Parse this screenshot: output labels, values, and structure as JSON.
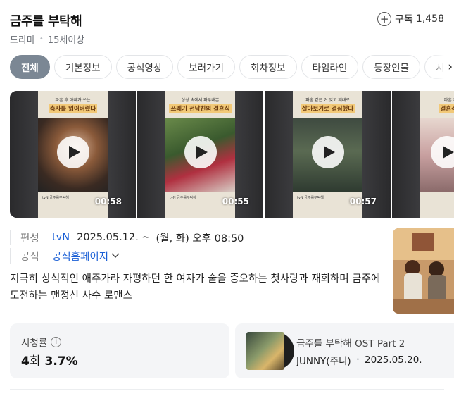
{
  "header": {
    "title": "금주를 부탁해",
    "genre": "드라마",
    "rating_age": "15세이상",
    "subscribe_label": "구독",
    "subscribe_count": "1,458"
  },
  "tabs": [
    "전체",
    "기본정보",
    "공식영상",
    "보러가기",
    "회차정보",
    "타임라인",
    "등장인물",
    "시청"
  ],
  "clips": [
    {
      "caption_top": "파혼 후 아빠가 쓰는",
      "caption_main": "축사를 읽어버렸다",
      "brand": "tvN 금주를부탁해",
      "duration": "00:58"
    },
    {
      "caption_top": "상상 속에서 파투내본",
      "caption_main": "쓰레기 전남친의 결혼식",
      "brand": "tvN 금주를부탁해",
      "duration": "00:55"
    },
    {
      "caption_top": "파혼 같은 거 잊고 제대로",
      "caption_main": "살아보기로 결심했다",
      "brand": "tvN 금주를부탁해",
      "duration": "00:57"
    },
    {
      "caption_top": "파혼 후 파혼",
      "caption_main": "결혼식 버스",
      "brand": "",
      "duration": ""
    }
  ],
  "info": {
    "broadcast_label": "편성",
    "channel": "tvN",
    "schedule_date": "2025.05.12. ~",
    "schedule_time": "(월, 화) 오후 08:50",
    "official_label": "공식",
    "official_link": "공식홈페이지",
    "synopsis": "지극히 상식적인 애주가라 자평하던 한 여자가 술을 증오하는 첫사랑과 재회하며 금주에 도전하는 맨정신 사수 로맨스"
  },
  "rating_card": {
    "label": "시청률",
    "episode": "4",
    "episode_unit": "회",
    "value": "3.7%"
  },
  "ost_card": {
    "title": "금주를 부탁해 OST Part 2",
    "artist": "JUNNY(주니)",
    "date": "2025.05.20."
  }
}
